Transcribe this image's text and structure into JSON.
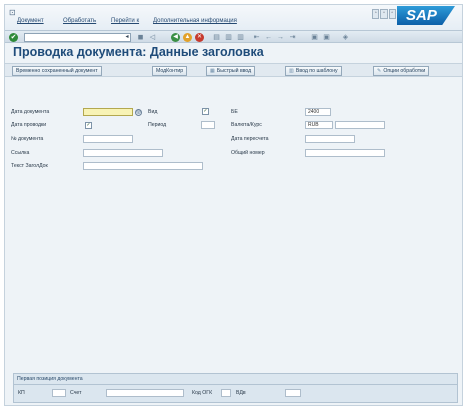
{
  "menubar": {
    "items": [
      "Документ",
      "Обработать",
      "Перейти к",
      "Дополнительная информация"
    ],
    "window_buttons": [
      "▫",
      "▫",
      "▫"
    ],
    "logo_text": "SAP"
  },
  "toolbar": {
    "command_field_value": "",
    "icons": [
      "check-icon",
      "save-icon",
      "back-icon",
      "exit-icon",
      "cancel-icon",
      "print-icon",
      "find-icon",
      "find-next-icon",
      "first-page-icon",
      "prev-page-icon",
      "next-page-icon",
      "last-page-icon",
      "new-session-icon",
      "shortcut-icon",
      "help-icon"
    ]
  },
  "title": "Проводка документа: Данные заголовка",
  "app_toolbar": {
    "buttons": [
      {
        "label": "Временно сохраненный документ",
        "icon": ""
      },
      {
        "label": "МодКонтир",
        "icon": ""
      },
      {
        "label": "Быстрый ввод",
        "icon": "▦"
      },
      {
        "label": "Ввод по шаблону",
        "icon": "▥"
      },
      {
        "label": "Опции обработки",
        "icon": "✎"
      }
    ]
  },
  "form": {
    "doc_date_label": "Дата документа",
    "doc_date_value": "",
    "posting_date_label": "Дата проводки",
    "posting_date_value": "",
    "doc_number_label": "№ документа",
    "doc_number_value": "",
    "reference_label": "Ссылка",
    "reference_value": "",
    "header_text_label": "Текст ЗаголДок",
    "header_text_value": "",
    "type_label": "Вид",
    "period_label": "Период",
    "period_value": "",
    "company_code_label": "БЕ",
    "company_code_value": "2400",
    "currency_label": "Валюта/Курс",
    "currency_value": "RUB",
    "exchange_rate_value": "",
    "translation_date_label": "Дата пересчета",
    "translation_date_value": "",
    "total_number_label": "Общий номер",
    "total_number_value": ""
  },
  "first_item": {
    "title": "Первая позиция документа",
    "posting_key_label": "КП",
    "posting_key_value": "",
    "account_label": "Счет",
    "account_value": "",
    "sgl_label": "Код ОГК",
    "sgl_value": "",
    "transaction_type_label": "ВДв",
    "transaction_type_value": ""
  }
}
